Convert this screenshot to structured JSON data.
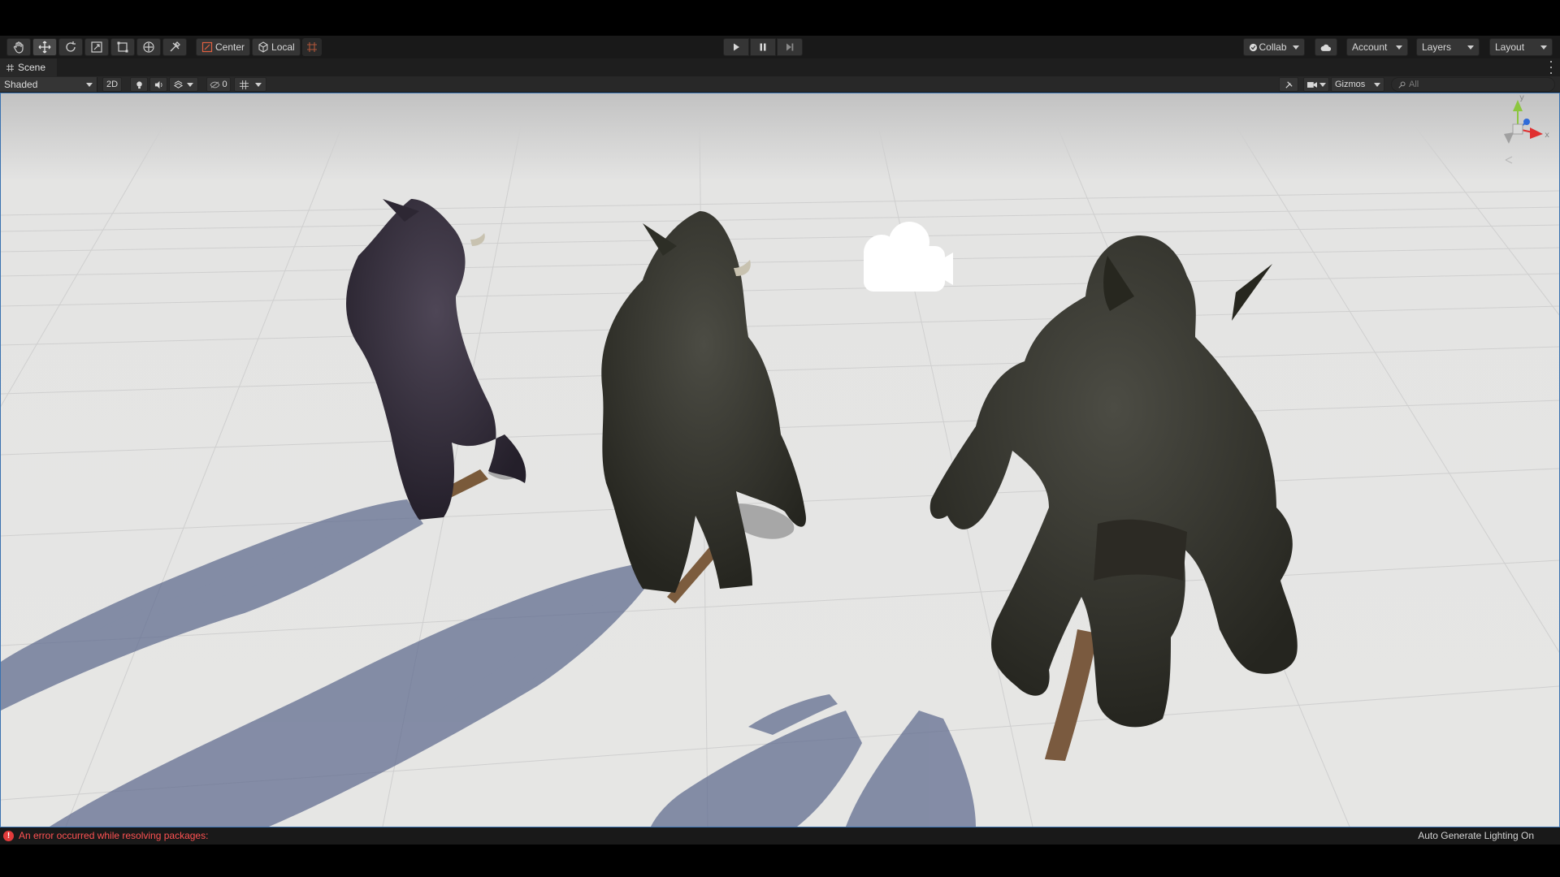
{
  "toolbar": {
    "tools": [
      {
        "name": "hand-tool",
        "icon": "hand-icon"
      },
      {
        "name": "move-tool",
        "icon": "move-icon",
        "active": true
      },
      {
        "name": "rotate-tool",
        "icon": "rotate-icon"
      },
      {
        "name": "scale-tool",
        "icon": "scale-icon"
      },
      {
        "name": "rect-tool",
        "icon": "rect-icon"
      },
      {
        "name": "transform-tool",
        "icon": "transform-icon"
      },
      {
        "name": "custom-tool",
        "icon": "tools-icon"
      }
    ],
    "pivot_label": "Center",
    "space_label": "Local",
    "collab_label": "Collab",
    "account_label": "Account",
    "layers_label": "Layers",
    "layout_label": "Layout"
  },
  "tab": {
    "label": "Scene"
  },
  "scene_toolbar": {
    "draw_mode": "Shaded",
    "toggle_2d": "2D",
    "hidden_count": "0",
    "gizmos_label": "Gizmos",
    "search_placeholder": "All"
  },
  "viewport": {
    "gizmo_axes": {
      "y": "y",
      "x": "x",
      "z": "z"
    }
  },
  "status": {
    "error_message": "An error occurred while resolving packages:",
    "lighting": "Auto Generate Lighting On"
  },
  "colors": {
    "accent": "#3a72b0",
    "error": "#ff5252",
    "toolbar_bg": "#191919",
    "panel_bg": "#282828"
  }
}
